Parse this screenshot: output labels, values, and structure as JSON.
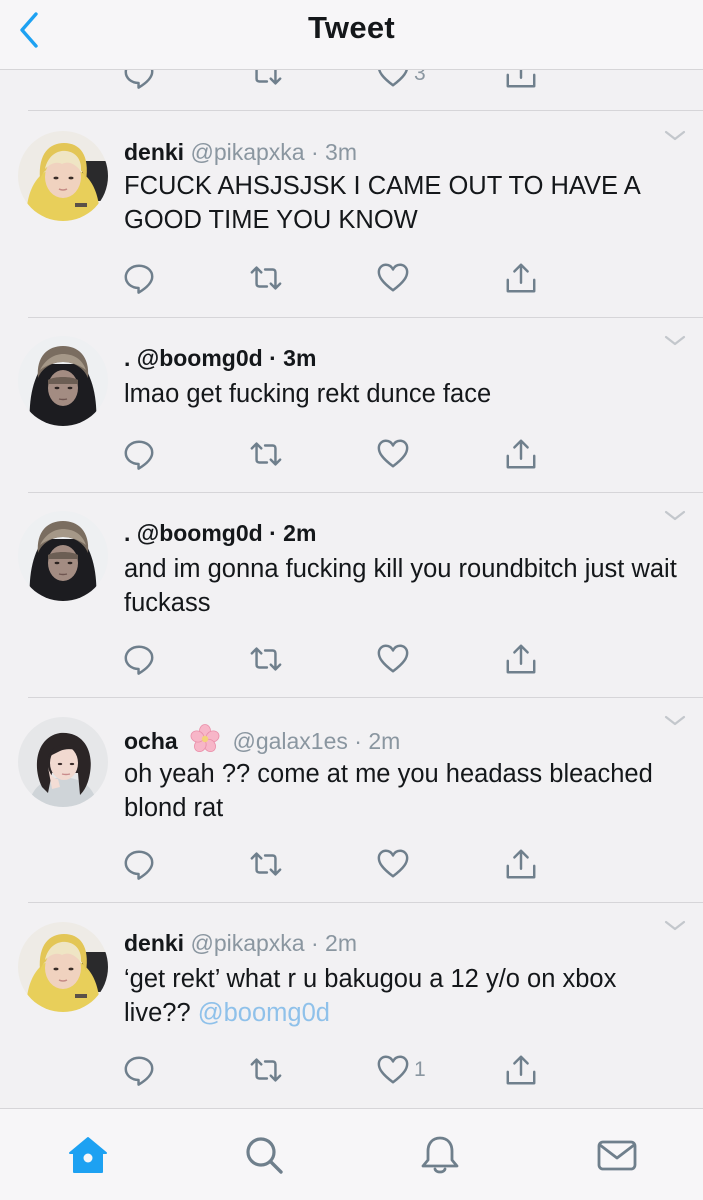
{
  "header": {
    "title": "Tweet"
  },
  "partial_tweet": {
    "like_count": "3"
  },
  "tweets": [
    {
      "name": "denki",
      "handle": "@pikapxka",
      "separator": " · ",
      "time": "3m",
      "text": "FCUCK AHSJSJSK I CAME OUT TO HAVE A GOOD TIME YOU KNOW",
      "like_count": ""
    },
    {
      "name": ".",
      "handle": "@boomg0d",
      "separator": " · ",
      "time": "3m",
      "text": "lmao get fucking rekt dunce face",
      "like_count": ""
    },
    {
      "name": ".",
      "handle": "@boomg0d",
      "separator": " · ",
      "time": "2m",
      "text": "and im gonna fucking kill you roundbitch just wait fuckass",
      "like_count": ""
    },
    {
      "name": "ocha",
      "handle": "@galax1es",
      "separator": " · ",
      "time": "2m",
      "text": "oh yeah ?? come at me you headass bleached blond rat",
      "like_count": ""
    },
    {
      "name": "denki",
      "handle": "@pikapxka",
      "separator": " · ",
      "time": "2m",
      "text": "‘get rekt’ what r u bakugou a 12 y/o on xbox live??",
      "mention": "@boomg0d",
      "like_count": "1"
    }
  ],
  "colors": {
    "accent": "#1da1f2",
    "icon": "#6f7f8c",
    "text": "#14171a",
    "secondary": "#8a96a0",
    "mention": "#8fc1ea",
    "background": "#f2f1f3"
  },
  "icons": {
    "back": "chevron-left-icon",
    "reply": "reply-icon",
    "retweet": "retweet-icon",
    "like": "heart-icon",
    "share": "share-icon",
    "more": "chevron-down-icon",
    "home": "home-icon",
    "search": "search-icon",
    "notifications": "bell-icon",
    "messages": "mail-icon"
  }
}
